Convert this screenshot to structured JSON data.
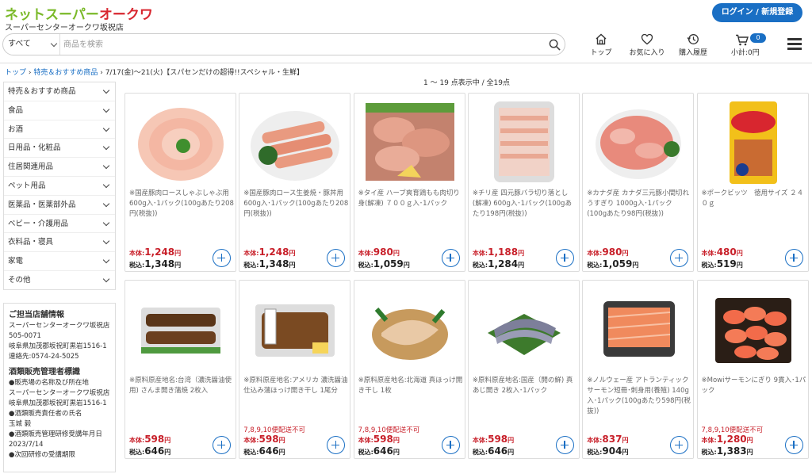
{
  "header": {
    "logo_main": "ネットスーパー",
    "logo_accent": "オークワ",
    "store_name": "スーパーセンターオークワ坂祝店",
    "login_label": "ログイン / 新規登録",
    "search_category": "すべて",
    "search_placeholder": "商品を検索",
    "nav": [
      {
        "label": "トップ",
        "icon": "home-icon"
      },
      {
        "label": "お気に入り",
        "icon": "heart-icon"
      },
      {
        "label": "購入履歴",
        "icon": "history-icon"
      }
    ],
    "cart_count": "0",
    "cart_subtotal": "小計:0円"
  },
  "breadcrumb": {
    "top": "トップ",
    "sep": " › ",
    "parent": "特売＆おすすめ商品",
    "current": "7/17(金)〜21(火)【スパセンだけの超得!!スペシャル・生鮮】"
  },
  "result_count": "1 〜 19 点表示中 /  全19点",
  "sidebar": {
    "items": [
      "特売＆おすすめ商品",
      "食品",
      "お酒",
      "日用品・化粧品",
      "住居関連用品",
      "ペット用品",
      "医薬品・医薬部外品",
      "ベビー・介護用品",
      "衣料品・寝具",
      "家電",
      "その他"
    ]
  },
  "store_info": {
    "title": "ご担当店舗情報",
    "lines": [
      "スーパーセンターオークワ坂祝店",
      "505-0071",
      "岐阜県加茂郡坂祝町黒岩1516-1",
      "連絡先:0574-24-5025"
    ],
    "title2": "酒類販売管理者標識",
    "lines2": [
      "●販売場の名称及び所在地",
      "スーパーセンターオークワ坂祝店",
      "岐阜県加茂郡坂祝町黒岩1516-1",
      "●酒類販売責任者の氏名",
      "玉城 毅",
      "●酒類販売管理研修受講年月日",
      "2023/7/14",
      "●次回研修の受講期限"
    ]
  },
  "labels": {
    "base": "本体:",
    "tax": "税込:",
    "yen": "円"
  },
  "products": [
    {
      "name": "※国産豚肉ロースしゃぶしゃぶ用 600g入･1パック(100gあたり208円(税抜))",
      "base": "1,248",
      "tax": "1,348",
      "note": "",
      "image": "pork-shabu"
    },
    {
      "name": "※国産豚肉ロース生姜焼・豚丼用 600g入･1パック(100gあたり208円(税抜))",
      "base": "1,248",
      "tax": "1,348",
      "note": "",
      "image": "pork-loin"
    },
    {
      "name": "※タイ産 ハーブ爽育鶏もも肉切り身(解凍) ７００ｇ入･1パック",
      "base": "980",
      "tax": "1,059",
      "note": "",
      "image": "chicken"
    },
    {
      "name": "※チリ産 四元豚バラ切り落とし(解凍) 600g入･1パック(100gあたり198円(税抜))",
      "base": "1,188",
      "tax": "1,284",
      "note": "",
      "image": "pork-belly"
    },
    {
      "name": "※カナダ産 カナダ三元豚小間切れうすぎり 1000g入･1パック(100gあたり98円(税抜))",
      "base": "980",
      "tax": "1,059",
      "note": "",
      "image": "pork-koma"
    },
    {
      "name": "※ポークビッツ　徳用サイズ ２４０ｇ",
      "base": "480",
      "tax": "519",
      "note": "",
      "image": "pork-bits"
    },
    {
      "name": "※原料原産地名:台湾（濃洗醤油使用) さんま開き蒲焼 2枚入",
      "base": "598",
      "tax": "646",
      "note": "",
      "image": "saury"
    },
    {
      "name": "※原料原産地名:アメリカ 濃洗醤油仕込み蒲ほっけ開き干し 1尾分",
      "base": "598",
      "tax": "646",
      "note": "7,8,9,10便配送不可",
      "image": "hokke-kabayaki"
    },
    {
      "name": "※原料原産地名:北海道 真ほっけ開き干し 1枚",
      "base": "598",
      "tax": "646",
      "note": "7,8,9,10便配送不可",
      "image": "hokke"
    },
    {
      "name": "※原料原産地名:国産（開の鮮) 真あじ開き 2枚入･1パック",
      "base": "598",
      "tax": "646",
      "note": "",
      "image": "aji"
    },
    {
      "name": "※ノルウェー産 アトランティックサーモン短冊･刺身用(養殖) 140g入･1パック(100gあたり598円(税抜))",
      "base": "837",
      "tax": "904",
      "note": "",
      "image": "salmon"
    },
    {
      "name": "※Mowiサーモンにぎり 9貫入･1パック",
      "base": "1,280",
      "tax": "1,383",
      "note": "7,8,9,10便配送不可",
      "image": "sushi"
    }
  ]
}
